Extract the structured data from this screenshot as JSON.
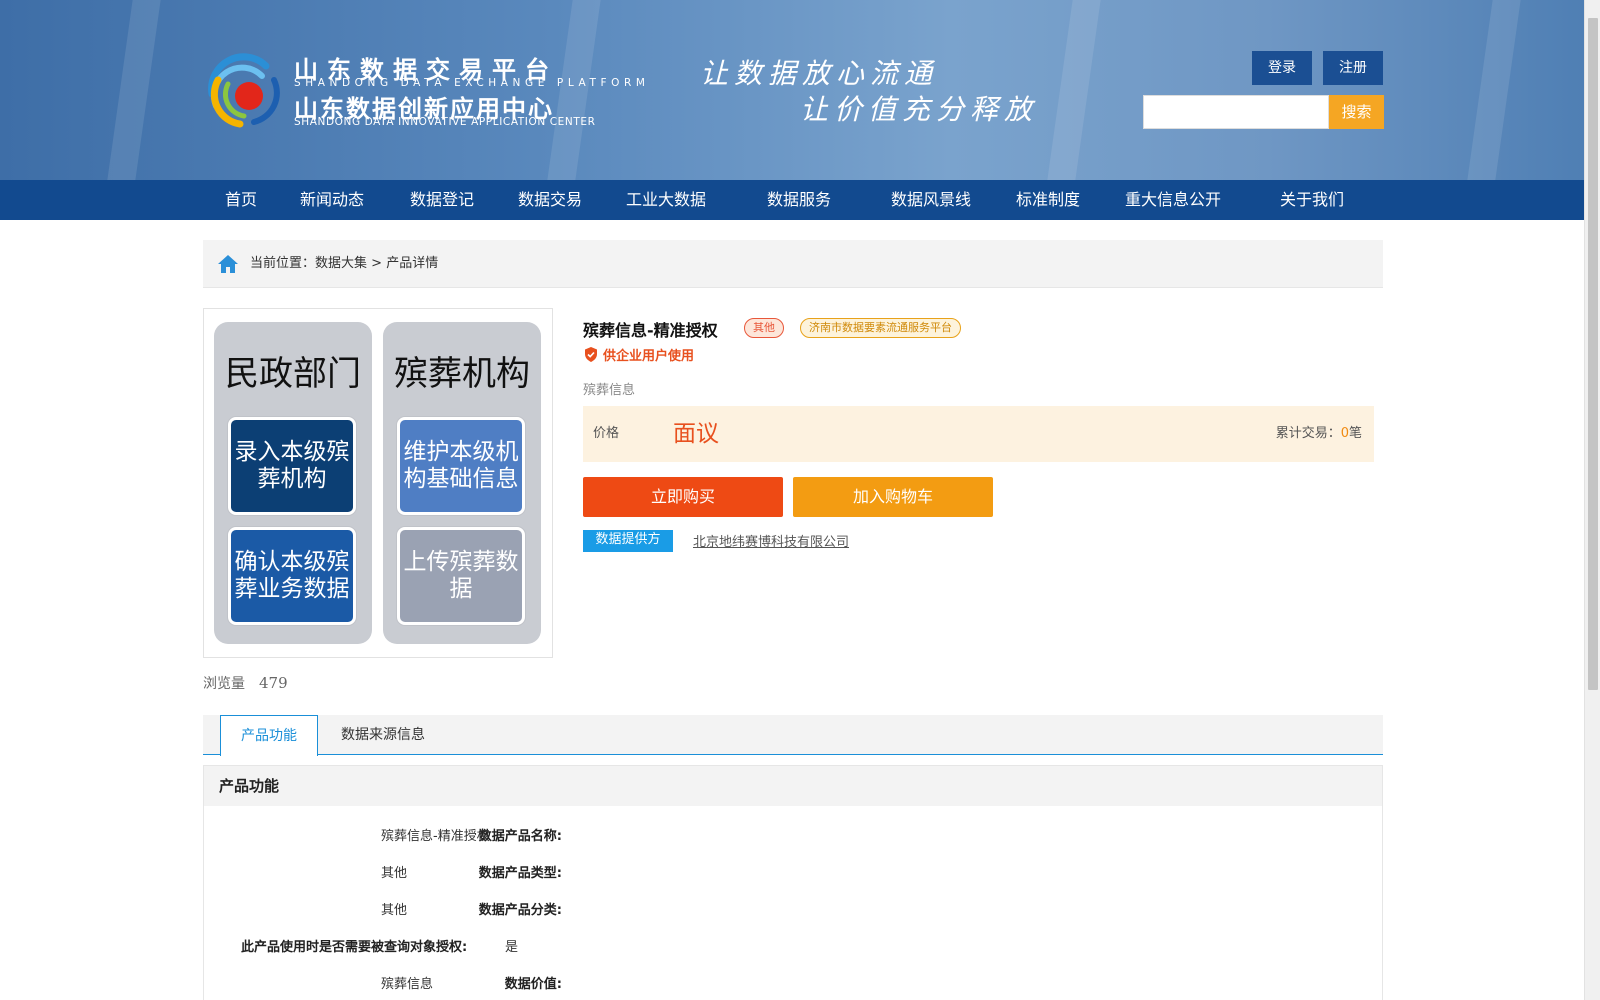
{
  "header": {
    "logo_cn_1": "山东数据交易平台",
    "logo_en_1": "SHANDONG DATA EXCHANGE PLATFORM",
    "logo_cn_2": "山东数据创新应用中心",
    "logo_en_2": "SHANDONG DATA INNOVATIVE APPLICATION CENTER",
    "slogan_1": "让数据放心流通",
    "slogan_2": "让价值充分释放",
    "login_label": "登录",
    "register_label": "注册",
    "search_value": "",
    "search_label": "搜索"
  },
  "nav": {
    "items": [
      "首页",
      "新闻动态",
      "数据登记",
      "数据交易",
      "工业大数据",
      "数据服务",
      "数据风景线",
      "标准制度",
      "重大信息公开",
      "关于我们"
    ]
  },
  "breadcrumb": {
    "prefix": "当前位置：",
    "path_1": "数据大集",
    "separator": " > ",
    "path_2": "产品详情"
  },
  "diagram": {
    "left_title": "民政部门",
    "right_title": "殡葬机构",
    "left_box_1": "录入本级殡葬机构",
    "left_box_2": "确认本级殡葬业务数据",
    "right_box_1": "维护本级机构基础信息",
    "right_box_2": "上传殡葬数据",
    "colors": {
      "box_dark": "#0c3f74",
      "box_mid": "#1b5aa6",
      "box_light": "#4f7ec4",
      "box_gray": "#9aa2b3",
      "column_bg": "#c9ccd2"
    }
  },
  "product": {
    "title": "殡葬信息-精准授权",
    "tag_type": "其他",
    "tag_platform": "济南市数据要素流通服务平台",
    "user_badge": "供企业用户使用",
    "description": "殡葬信息",
    "price_label": "价格",
    "price_value": "面议",
    "trade_prefix": "累计交易：",
    "trade_count": "0",
    "trade_unit": "笔",
    "buy_label": "立即购买",
    "cart_label": "加入购物车",
    "provider_label": "数据提供方",
    "provider_name": "北京地纬赛博科技有限公司"
  },
  "views": {
    "label": "浏览量",
    "count": "479"
  },
  "tabs": {
    "function_label": "产品功能",
    "source_label": "数据来源信息",
    "active": "产品功能"
  },
  "section": {
    "title": "产品功能",
    "fields": [
      {
        "label": "数据产品名称:",
        "value": "殡葬信息-精准授权"
      },
      {
        "label": "数据产品类型:",
        "value": "其他"
      },
      {
        "label": "数据产品分类:",
        "value": "其他"
      },
      {
        "label": "此产品使用时是否需要被查询对象授权:",
        "value": "是"
      },
      {
        "label": "数据价值:",
        "value": "殡葬信息"
      }
    ]
  },
  "colors": {
    "nav_bg": "#124a8f",
    "accent_blue": "#1a8fd8",
    "buy_orange": "#ee4a14",
    "cart_orange": "#f39c12",
    "price_bg": "#fdf2e0"
  }
}
